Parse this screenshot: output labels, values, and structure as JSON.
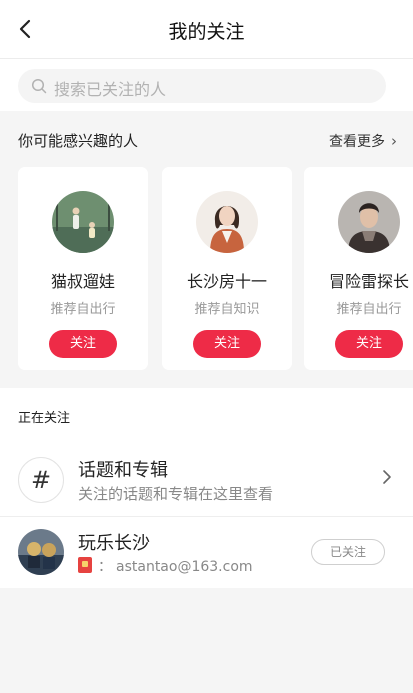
{
  "header": {
    "title": "我的关注",
    "back_icon": "back-arrow-icon"
  },
  "search": {
    "placeholder": "搜索已关注的人",
    "icon": "search-icon"
  },
  "recommend": {
    "title": "你可能感兴趣的人",
    "see_more": "查看更多",
    "cards": [
      {
        "name": "猫叔遛娃",
        "subtitle": "推荐自出行",
        "button": "关注"
      },
      {
        "name": "长沙房十一",
        "subtitle": "推荐自知识",
        "button": "关注"
      },
      {
        "name": "冒险雷探长",
        "subtitle": "推荐自出行",
        "button": "关注"
      }
    ]
  },
  "following": {
    "title": "正在关注",
    "topics": {
      "title": "话题和专辑",
      "subtitle": "关注的话题和专辑在这里查看",
      "icon": "hashtag-icon"
    },
    "user": {
      "name": "玩乐长沙",
      "sep": "：",
      "email": "astantao@163.com",
      "button": "已关注"
    }
  },
  "colors": {
    "accent": "#ee2b47",
    "background": "#f5f5f5"
  }
}
